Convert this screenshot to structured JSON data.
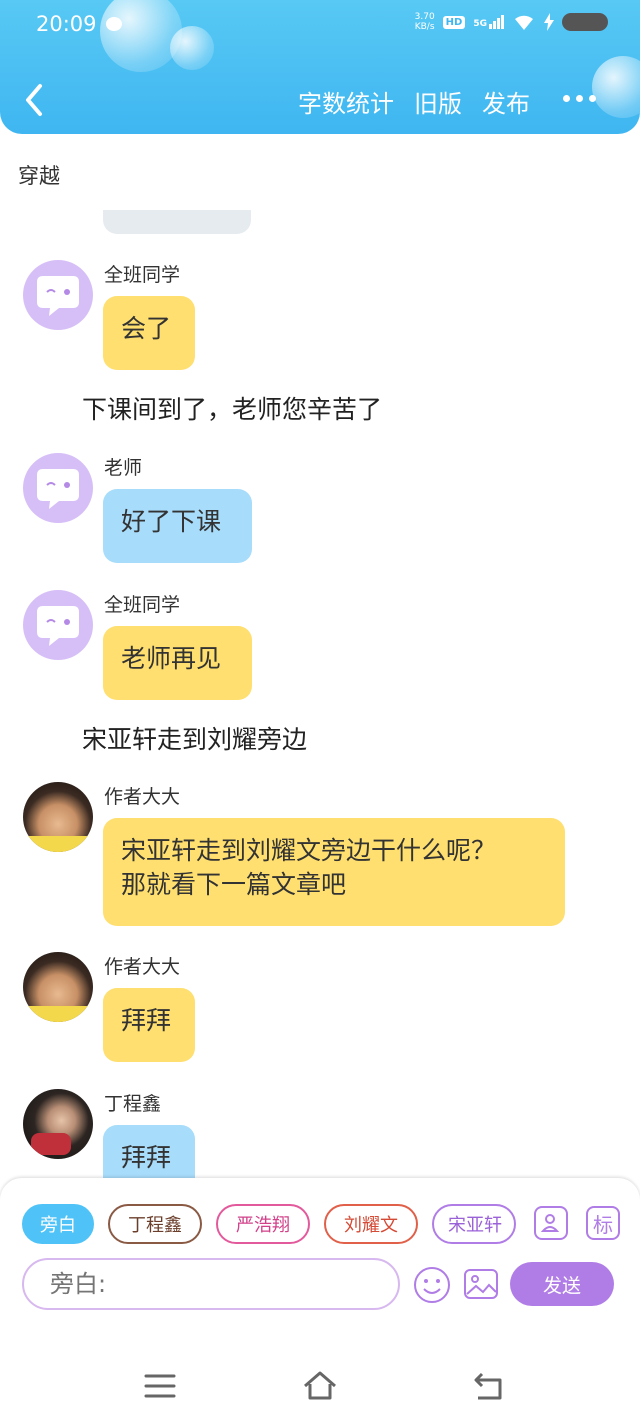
{
  "status_bar": {
    "time": "20:09",
    "net_speed_value": "3.70",
    "net_speed_unit": "KB/s",
    "hd_label": "HD",
    "network": "5G"
  },
  "toolbar": {
    "word_count": "字数统计",
    "old_version": "旧版",
    "publish": "发布"
  },
  "title": "穿越",
  "messages": [
    {
      "type": "bubble",
      "speaker": "全班同学",
      "text": "会了",
      "color": "#fedf6f",
      "avatar": "chat-bubble-avatar"
    },
    {
      "type": "narration",
      "text": "下课间到了，老师您辛苦了"
    },
    {
      "type": "bubble",
      "speaker": "老师",
      "text": "好了下课",
      "color": "#a8dcfb",
      "avatar": "chat-bubble-avatar"
    },
    {
      "type": "bubble",
      "speaker": "全班同学",
      "text": "老师再见",
      "color": "#fedf6f",
      "avatar": "chat-bubble-avatar"
    },
    {
      "type": "narration",
      "text": "宋亚轩走到刘耀旁边"
    },
    {
      "type": "bubble",
      "speaker": "作者大大",
      "text_line1": "宋亚轩走到刘耀文旁边干什么呢？",
      "text_line2": "那就看下一篇文章吧",
      "color": "#fedf6f",
      "avatar": "photo-avatar"
    },
    {
      "type": "bubble",
      "speaker": "作者大大",
      "text": "拜拜",
      "color": "#fedf6f",
      "avatar": "photo-avatar"
    },
    {
      "type": "bubble",
      "speaker": "丁程鑫",
      "text": "拜拜",
      "color": "#a8dcfb",
      "avatar": "photo-avatar"
    }
  ],
  "composer": {
    "roles": [
      "旁白",
      "丁程鑫",
      "严浩翔",
      "刘耀文",
      "宋亚轩"
    ],
    "active_role": "旁白",
    "label_button": "标",
    "input_placeholder": "旁白:",
    "send_label": "发送"
  },
  "colors": {
    "header": "#3fb6f1",
    "yellow_bubble": "#fedf6f",
    "blue_bubble": "#a8dcfb",
    "accent_purple": "#b07de6"
  }
}
